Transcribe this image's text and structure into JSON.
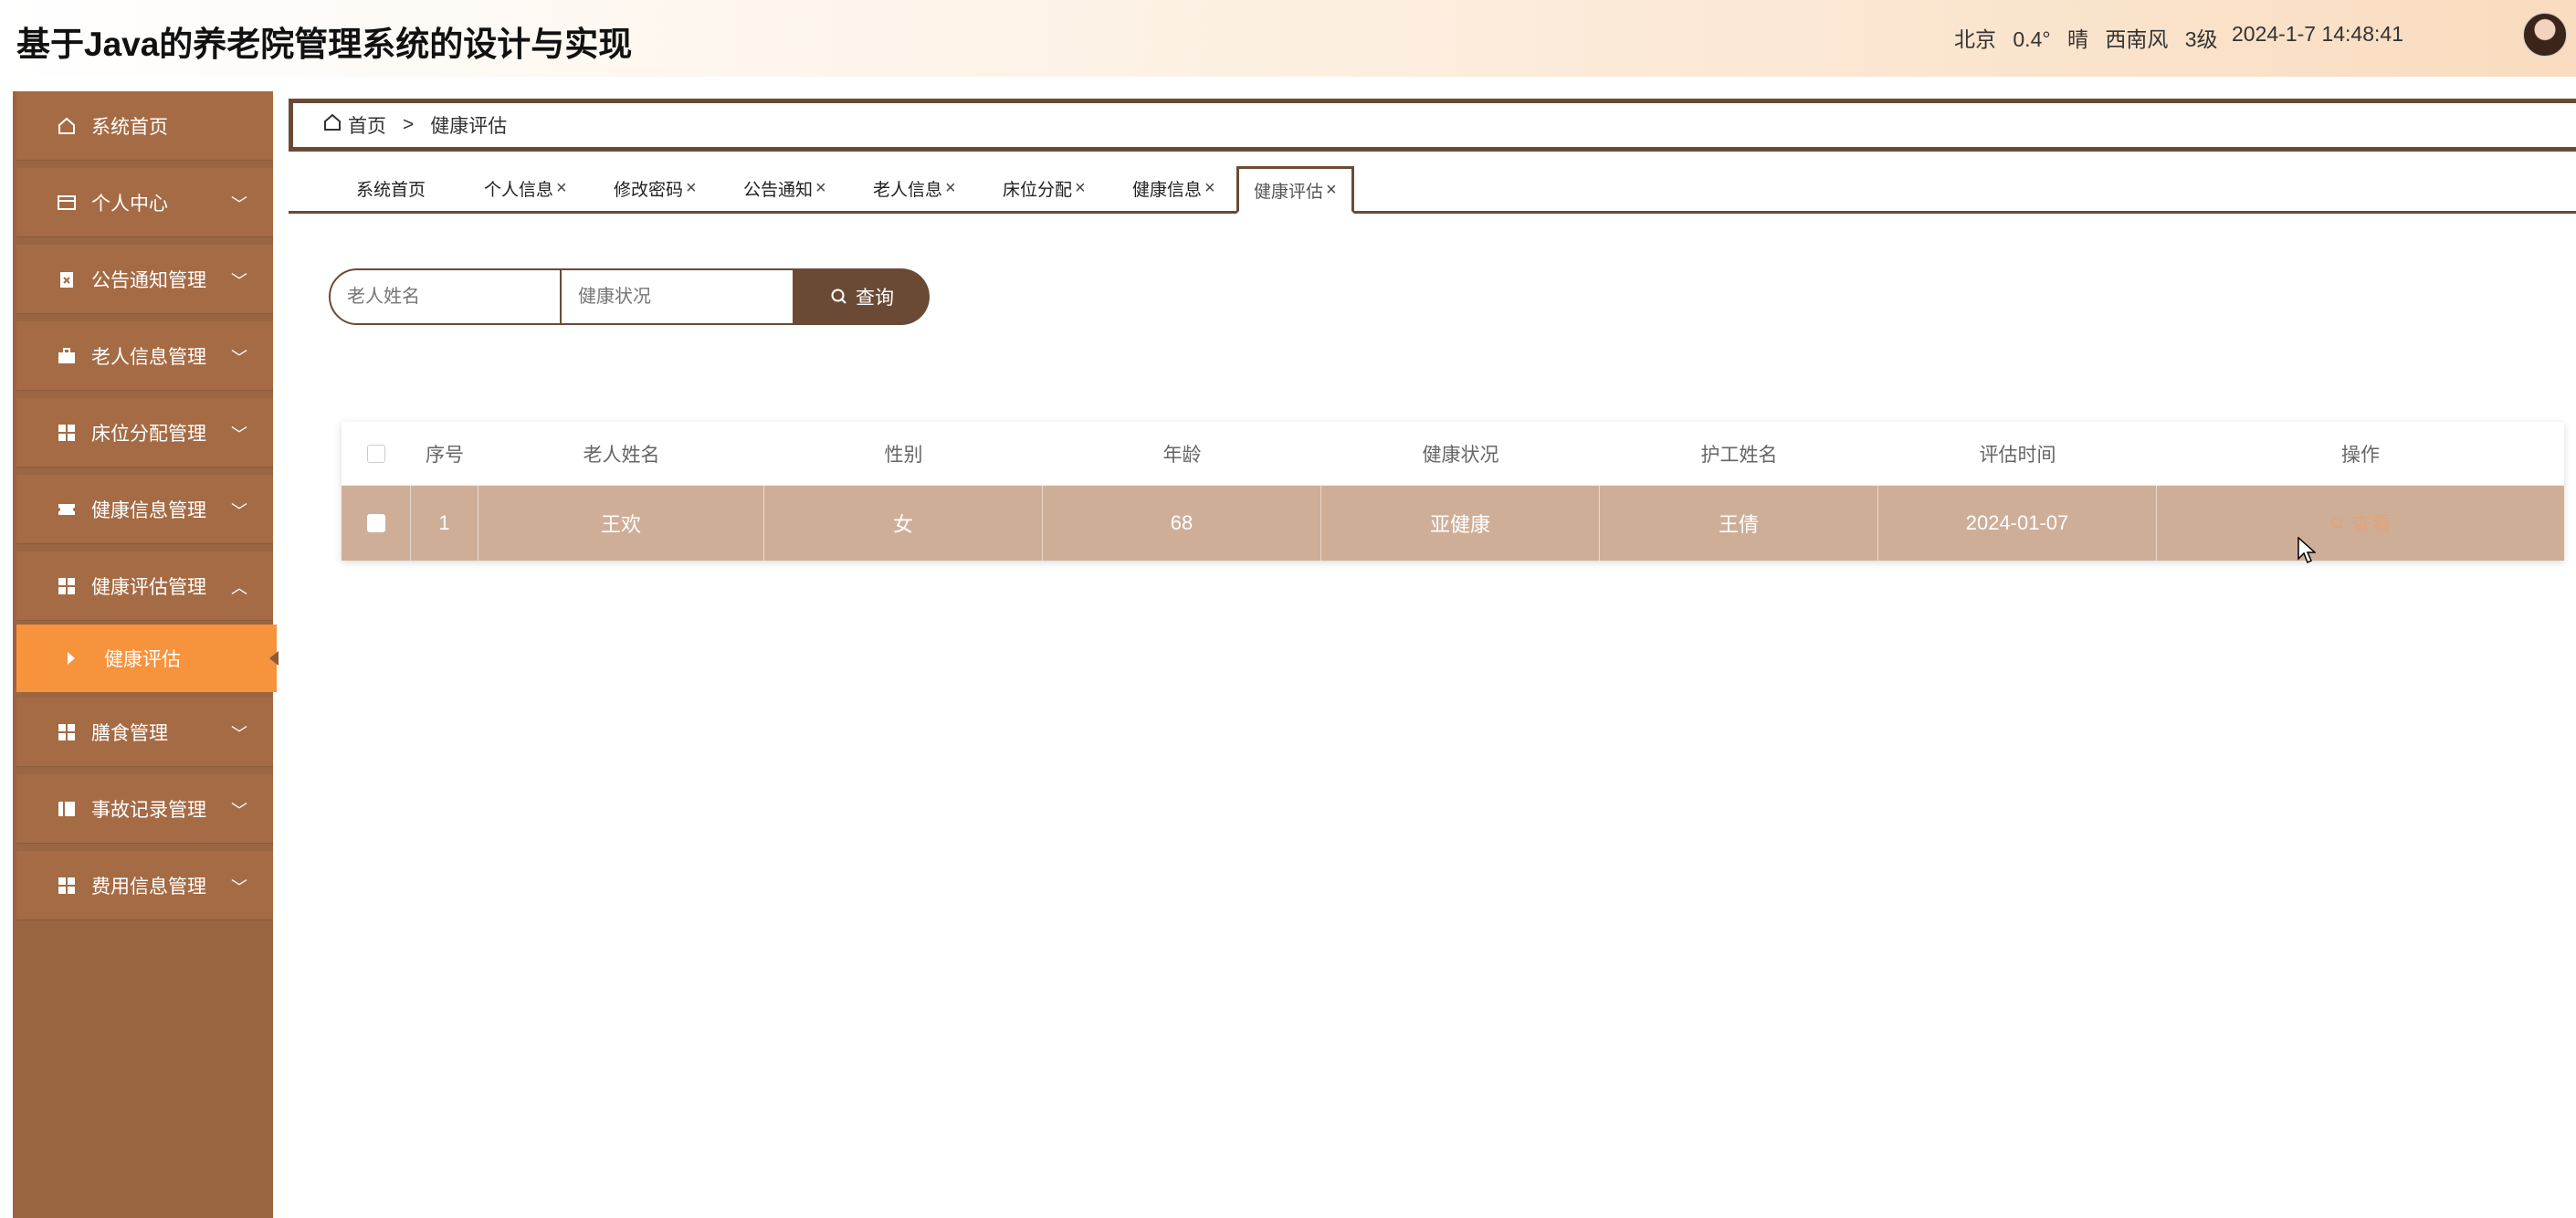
{
  "header": {
    "title": "基于Java的养老院管理系统的设计与实现",
    "weather": "北京  0.4°  晴  西南风  3级",
    "datetime": "2024-1-7 14:48:41"
  },
  "sidebar": {
    "items": [
      {
        "label": "系统首页",
        "icon": "home-icon"
      },
      {
        "label": "个人中心",
        "icon": "wallet-icon"
      },
      {
        "label": "公告通知管理",
        "icon": "clipboard-icon"
      },
      {
        "label": "老人信息管理",
        "icon": "briefcase-icon"
      },
      {
        "label": "床位分配管理",
        "icon": "grid-icon"
      },
      {
        "label": "健康信息管理",
        "icon": "ticket-icon"
      },
      {
        "label": "健康评估管理",
        "icon": "grid-icon"
      },
      {
        "label": "膳食管理",
        "icon": "grid-icon"
      },
      {
        "label": "事故记录管理",
        "icon": "book-icon"
      },
      {
        "label": "费用信息管理",
        "icon": "grid-icon"
      }
    ],
    "active_sub": "健康评估"
  },
  "breadcrumb": {
    "home": "首页",
    "separator": ">",
    "current": "健康评估"
  },
  "tabs": [
    {
      "label": "系统首页",
      "closable": false
    },
    {
      "label": "个人信息",
      "closable": true
    },
    {
      "label": "修改密码",
      "closable": true
    },
    {
      "label": "公告通知",
      "closable": true
    },
    {
      "label": "老人信息",
      "closable": true
    },
    {
      "label": "床位分配",
      "closable": true
    },
    {
      "label": "健康信息",
      "closable": true
    },
    {
      "label": "健康评估",
      "closable": true
    }
  ],
  "search": {
    "name_placeholder": "老人姓名",
    "status_placeholder": "健康状况",
    "button": "查询"
  },
  "table": {
    "headers": [
      "序号",
      "老人姓名",
      "性别",
      "年龄",
      "健康状况",
      "护工姓名",
      "评估时间",
      "操作"
    ],
    "rows": [
      {
        "index": "1",
        "name": "王欢",
        "sex": "女",
        "age": "68",
        "health": "亚健康",
        "nurse": "王倩",
        "time": "2024-01-07",
        "action": "查看"
      }
    ]
  },
  "colors": {
    "sidebar": "#a56b45",
    "accent": "#6b4a35",
    "active_sub": "#f7923d",
    "row": "#cfae98"
  }
}
